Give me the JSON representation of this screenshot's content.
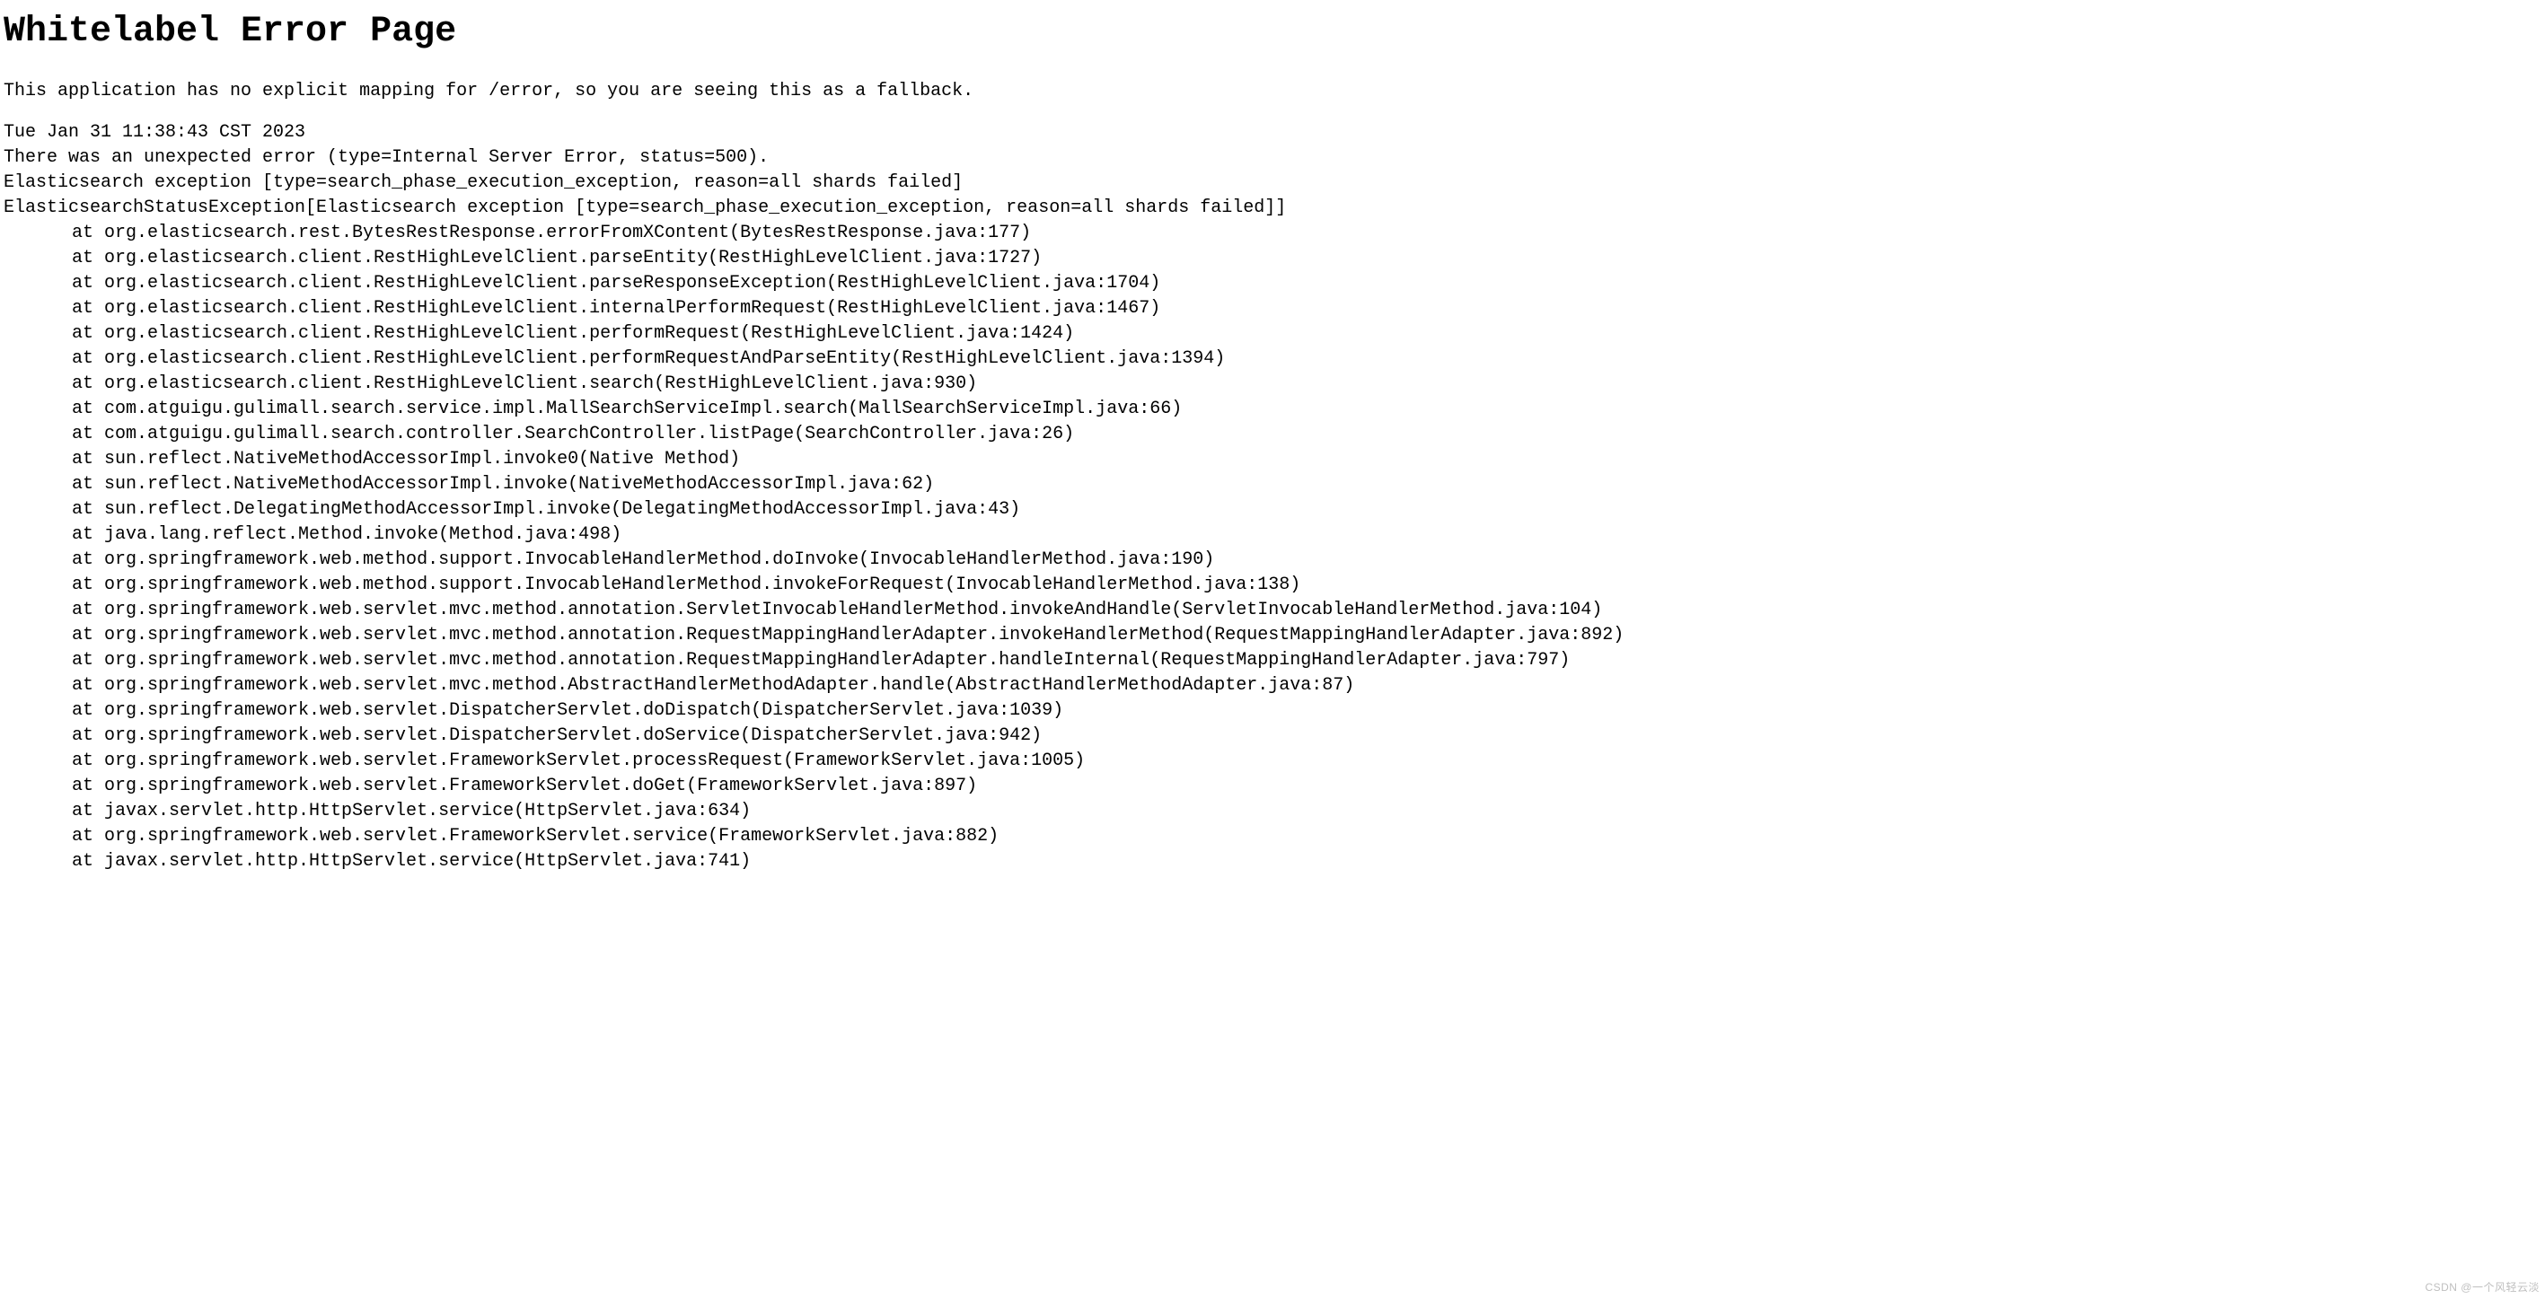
{
  "page_title": "Whitelabel Error Page",
  "intro": "This application has no explicit mapping for /error, so you are seeing this as a fallback.",
  "timestamp": "Tue Jan 31 11:38:43 CST 2023",
  "error_summary": "There was an unexpected error (type=Internal Server Error, status=500).",
  "exception_short": "Elasticsearch exception [type=search_phase_execution_exception, reason=all shards failed]",
  "exception_full": "ElasticsearchStatusException[Elasticsearch exception [type=search_phase_execution_exception, reason=all shards failed]]",
  "trace": [
    "at org.elasticsearch.rest.BytesRestResponse.errorFromXContent(BytesRestResponse.java:177)",
    "at org.elasticsearch.client.RestHighLevelClient.parseEntity(RestHighLevelClient.java:1727)",
    "at org.elasticsearch.client.RestHighLevelClient.parseResponseException(RestHighLevelClient.java:1704)",
    "at org.elasticsearch.client.RestHighLevelClient.internalPerformRequest(RestHighLevelClient.java:1467)",
    "at org.elasticsearch.client.RestHighLevelClient.performRequest(RestHighLevelClient.java:1424)",
    "at org.elasticsearch.client.RestHighLevelClient.performRequestAndParseEntity(RestHighLevelClient.java:1394)",
    "at org.elasticsearch.client.RestHighLevelClient.search(RestHighLevelClient.java:930)",
    "at com.atguigu.gulimall.search.service.impl.MallSearchServiceImpl.search(MallSearchServiceImpl.java:66)",
    "at com.atguigu.gulimall.search.controller.SearchController.listPage(SearchController.java:26)",
    "at sun.reflect.NativeMethodAccessorImpl.invoke0(Native Method)",
    "at sun.reflect.NativeMethodAccessorImpl.invoke(NativeMethodAccessorImpl.java:62)",
    "at sun.reflect.DelegatingMethodAccessorImpl.invoke(DelegatingMethodAccessorImpl.java:43)",
    "at java.lang.reflect.Method.invoke(Method.java:498)",
    "at org.springframework.web.method.support.InvocableHandlerMethod.doInvoke(InvocableHandlerMethod.java:190)",
    "at org.springframework.web.method.support.InvocableHandlerMethod.invokeForRequest(InvocableHandlerMethod.java:138)",
    "at org.springframework.web.servlet.mvc.method.annotation.ServletInvocableHandlerMethod.invokeAndHandle(ServletInvocableHandlerMethod.java:104)",
    "at org.springframework.web.servlet.mvc.method.annotation.RequestMappingHandlerAdapter.invokeHandlerMethod(RequestMappingHandlerAdapter.java:892)",
    "at org.springframework.web.servlet.mvc.method.annotation.RequestMappingHandlerAdapter.handleInternal(RequestMappingHandlerAdapter.java:797)",
    "at org.springframework.web.servlet.mvc.method.AbstractHandlerMethodAdapter.handle(AbstractHandlerMethodAdapter.java:87)",
    "at org.springframework.web.servlet.DispatcherServlet.doDispatch(DispatcherServlet.java:1039)",
    "at org.springframework.web.servlet.DispatcherServlet.doService(DispatcherServlet.java:942)",
    "at org.springframework.web.servlet.FrameworkServlet.processRequest(FrameworkServlet.java:1005)",
    "at org.springframework.web.servlet.FrameworkServlet.doGet(FrameworkServlet.java:897)",
    "at javax.servlet.http.HttpServlet.service(HttpServlet.java:634)",
    "at org.springframework.web.servlet.FrameworkServlet.service(FrameworkServlet.java:882)",
    "at javax.servlet.http.HttpServlet.service(HttpServlet.java:741)"
  ],
  "watermark": "CSDN @一个风轻云淡"
}
